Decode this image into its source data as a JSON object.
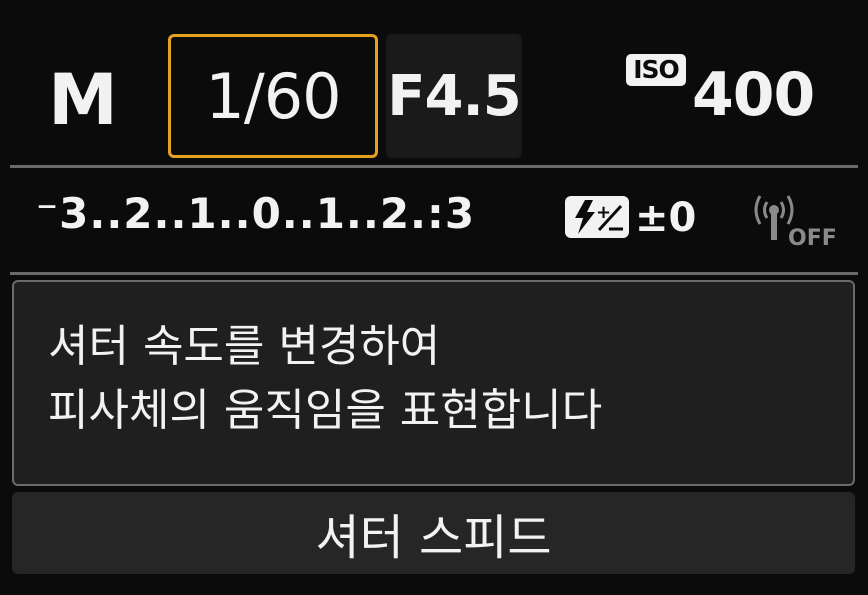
{
  "mode": "M",
  "shutter_speed": "1/60",
  "aperture": "F4.5",
  "iso": {
    "badge": "ISO",
    "value": "400"
  },
  "exposure_scale": "⁻3..2..1..0..1..2.:3",
  "flash_compensation": {
    "icon": "flash-compensation-icon",
    "value": "±0"
  },
  "wifi": {
    "icon": "wireless-antenna-icon",
    "status": "OFF"
  },
  "guide_text": {
    "line1": "셔터 속도를 변경하여",
    "line2": "피사체의 움직임을 표현합니다"
  },
  "footer_label": "셔터 스피드",
  "colors": {
    "highlight": "#e3a21a",
    "text": "#f2f2f2",
    "background": "#0b0b0b"
  }
}
